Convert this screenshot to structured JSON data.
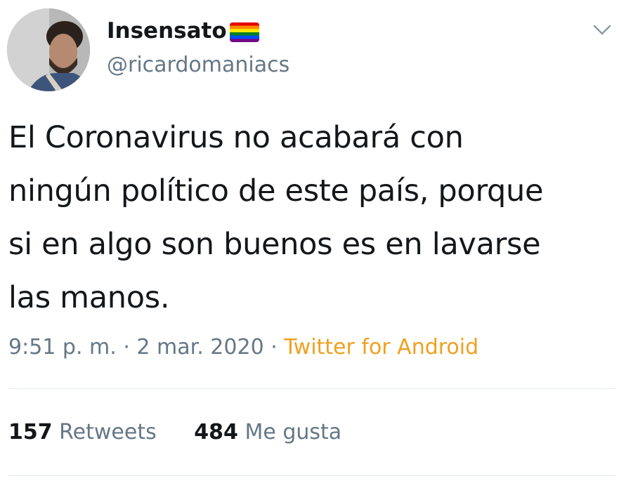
{
  "user": {
    "display_name": "Insensato",
    "handle": "@ricardomaniacs",
    "badge_icon": "rainbow-flag-icon"
  },
  "tweet": {
    "text": "El Coronavirus no acabará con\nningún político de este país, porque\nsi en algo son buenos es en lavarse\nlas manos."
  },
  "meta": {
    "time": "9:51 p. m.",
    "separator": "·",
    "date": "2 mar. 2020",
    "source": "Twitter for Android"
  },
  "stats": {
    "retweets_count": "157",
    "retweets_label": "Retweets",
    "likes_count": "484",
    "likes_label": "Me gusta"
  },
  "colors": {
    "text": "#14171a",
    "secondary": "#657786",
    "source_link": "#f0a020",
    "divider": "#e1e8ed"
  }
}
